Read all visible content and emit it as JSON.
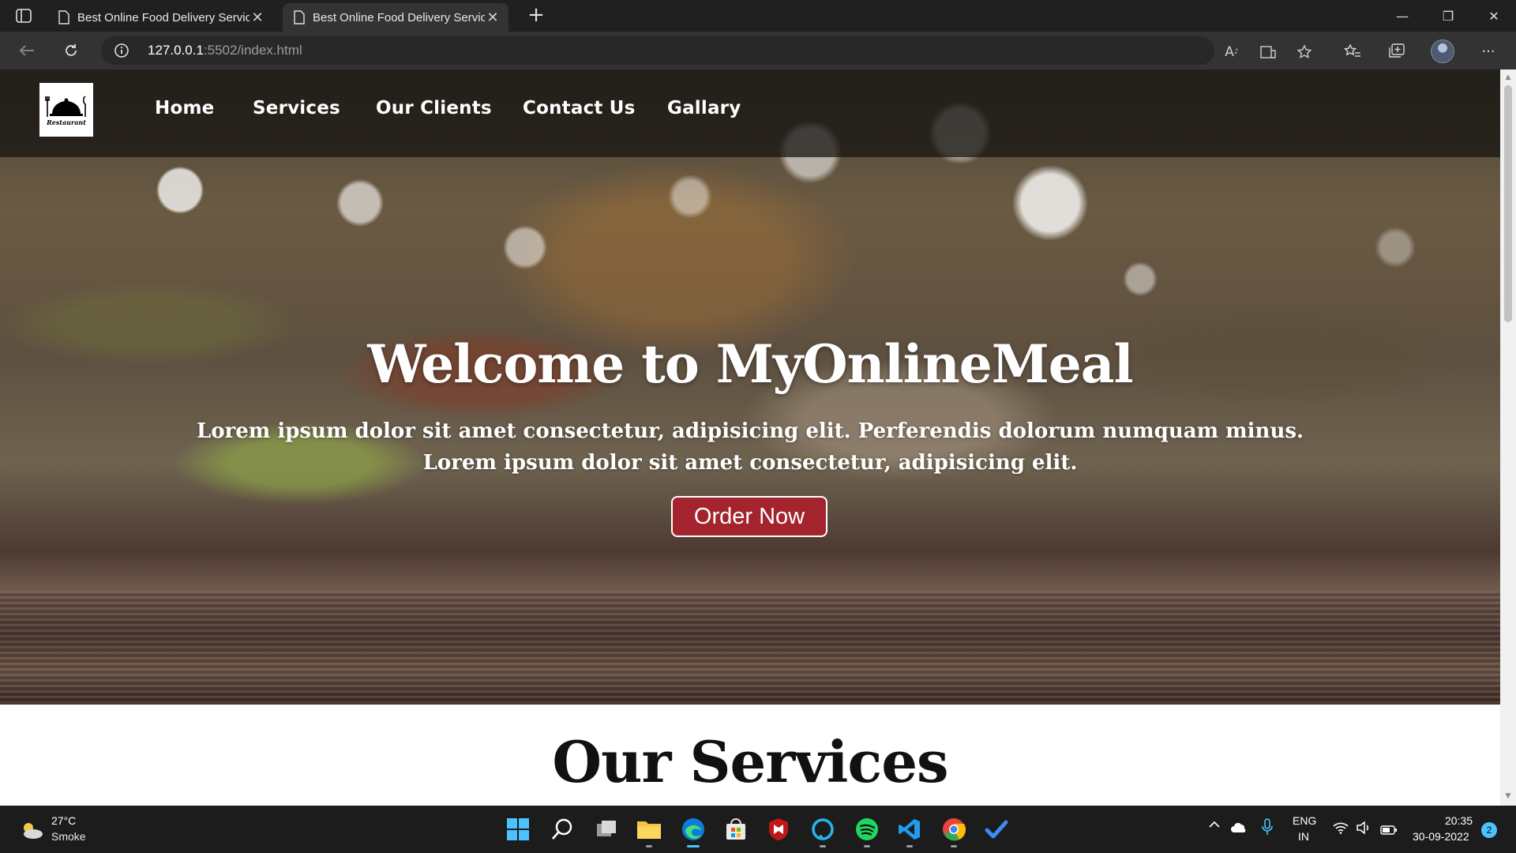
{
  "browser": {
    "tabs": [
      {
        "title": "Best Online Food Delivery Servic",
        "close": "✕"
      },
      {
        "title": "Best Online Food Delivery Servic",
        "close": "✕"
      }
    ],
    "new_tab": "+",
    "url_host": "127.0.0.1",
    "url_rest": ":5502/index.html",
    "window_controls": {
      "minimize": "—",
      "restore": "❐",
      "close": "✕"
    },
    "more": "···"
  },
  "site": {
    "logo_text": "Restaurant",
    "nav": [
      "Home",
      "Services",
      "Our Clients",
      "Contact Us",
      "Gallary"
    ],
    "hero_title": "Welcome to MyOnlineMeal",
    "hero_line1": "Lorem ipsum dolor sit amet consectetur, adipisicing elit. Perferendis dolorum numquam minus.",
    "hero_line2": "Lorem ipsum dolor sit amet consectetur, adipisicing elit.",
    "order_button": "Order Now",
    "services_title": "Our Services",
    "colors": {
      "accent": "#a3242c"
    }
  },
  "taskbar": {
    "weather_temp": "27°C",
    "weather_desc": "Smoke",
    "lang_top": "ENG",
    "lang_bottom": "IN",
    "time": "20:35",
    "date": "30-09-2022",
    "notifications": "2",
    "apps": [
      "start-icon",
      "search-icon",
      "task-view-icon",
      "file-explorer-icon",
      "edge-icon",
      "store-icon",
      "mcafee-icon",
      "alexa-icon",
      "spotify-icon",
      "vscode-icon",
      "chrome-icon",
      "todo-icon"
    ]
  }
}
